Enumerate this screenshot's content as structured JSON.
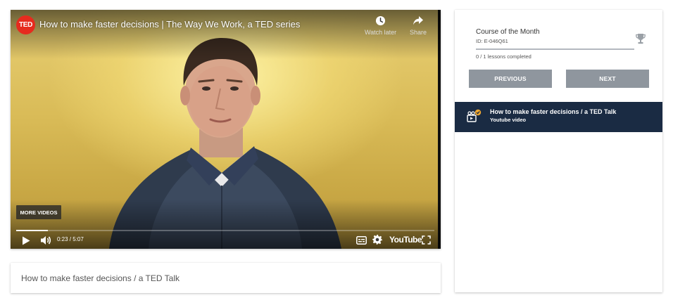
{
  "video": {
    "title": "How to make faster decisions | The Way We Work, a TED series",
    "channel_logo": "TED",
    "watch_later_label": "Watch later",
    "share_label": "Share",
    "more_videos_label": "MORE VIDEOS",
    "time_display": "0:23 / 5:07",
    "progress_fraction": 0.075,
    "youtube_logo": "YouTube",
    "icons": [
      "clock-icon",
      "share-arrow-icon",
      "play-icon",
      "volume-icon",
      "subtitles-icon",
      "gear-icon",
      "fullscreen-icon"
    ],
    "brand_color": "#e62b1e"
  },
  "caption": {
    "text": "How to make faster decisions / a TED Talk"
  },
  "course": {
    "title": "Course of the Month",
    "id": "ID: E-046Q61",
    "progress_text": "0 / 1 lessons completed",
    "trophy_icon": "trophy-icon"
  },
  "navigation": {
    "previous_label": "PREVIOUS",
    "next_label": "NEXT",
    "button_color": "#8f969e"
  },
  "lessons": [
    {
      "title": "How to make faster decisions / a TED Talk",
      "subtitle": "Youtube video",
      "icon": "video-lesson-icon",
      "status": "completed-check",
      "active_color": "#1a2b43"
    }
  ]
}
